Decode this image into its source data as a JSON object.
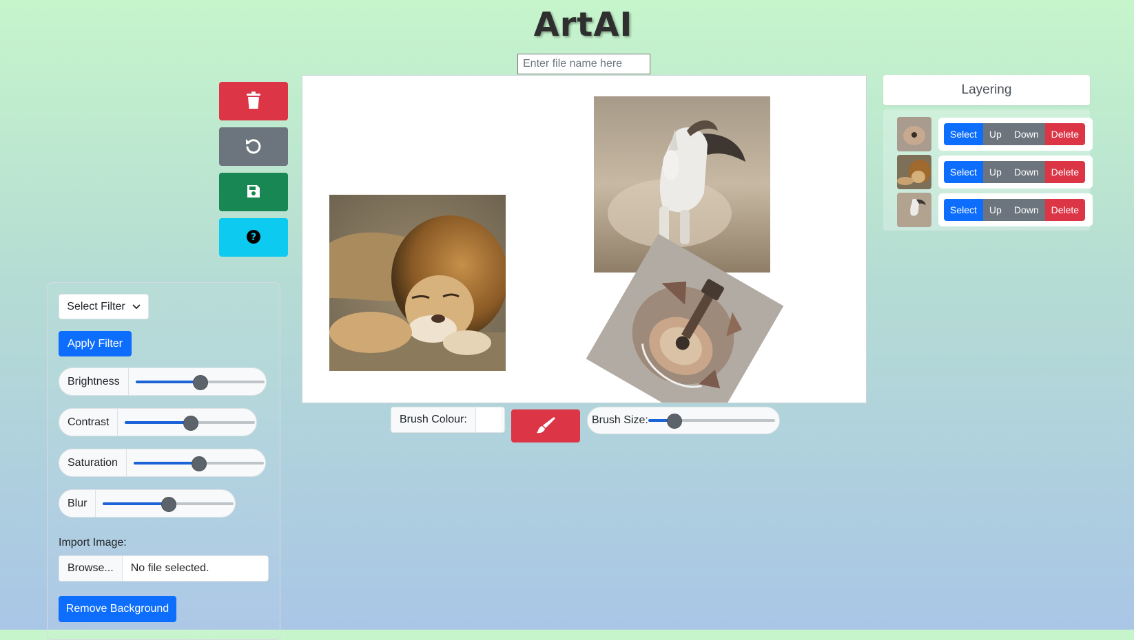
{
  "app": {
    "title": "ArtAI"
  },
  "filename": {
    "placeholder": "Enter file name here",
    "value": ""
  },
  "toolbar": {
    "buttons": [
      {
        "name": "delete",
        "icon": "trash-icon",
        "color": "#dc3545"
      },
      {
        "name": "undo",
        "icon": "undo-icon",
        "color": "#6c757d"
      },
      {
        "name": "save",
        "icon": "save-icon",
        "color": "#198754"
      },
      {
        "name": "help",
        "icon": "question-circle-icon",
        "color": "#0dcaf0"
      }
    ]
  },
  "filters": {
    "select_label": "Select Filter",
    "apply_label": "Apply Filter",
    "sliders": [
      {
        "label": "Brightness",
        "value": 0.5
      },
      {
        "label": "Contrast",
        "value": 0.5
      },
      {
        "label": "Saturation",
        "value": 0.5
      },
      {
        "label": "Blur",
        "value": 0.5
      }
    ],
    "import_label": "Import Image:",
    "browse_label": "Browse...",
    "file_status": "No file selected.",
    "remove_bg_label": "Remove Background"
  },
  "brush": {
    "colour_label": "Brush Colour:",
    "colour_value": "#ffffff",
    "toggle_icon": "paintbrush-icon",
    "size_label": "Brush Size:",
    "size_value": 0.2
  },
  "layering": {
    "title": "Layering",
    "layers": [
      {
        "thumb": "guitar-collage",
        "select": "Select",
        "up": "Up",
        "down": "Down",
        "delete": "Delete"
      },
      {
        "thumb": "sleeping-lion",
        "select": "Select",
        "up": "Up",
        "down": "Down",
        "delete": "Delete"
      },
      {
        "thumb": "running-horse",
        "select": "Select",
        "up": "Up",
        "down": "Down",
        "delete": "Delete"
      }
    ]
  },
  "canvas_images": [
    "sleeping-lion",
    "running-horse",
    "guitar-collage"
  ],
  "colors": {
    "primary": "#0d6efd",
    "danger": "#dc3545",
    "secondary": "#6c757d",
    "success": "#198754",
    "info": "#0dcaf0"
  }
}
